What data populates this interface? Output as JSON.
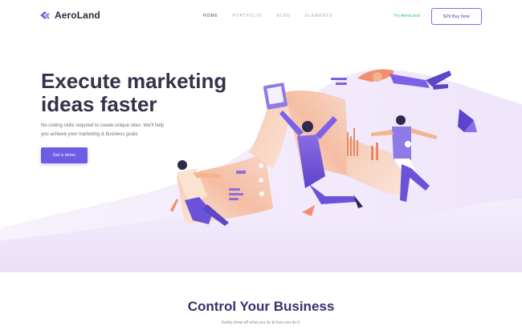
{
  "header": {
    "logo_text": "AeroLand",
    "nav": [
      {
        "label": "HOME",
        "active": true
      },
      {
        "label": "PORTFOLIO",
        "active": false
      },
      {
        "label": "BLOG",
        "active": false
      },
      {
        "label": "ELEMENTS",
        "active": false
      }
    ],
    "try_label": "Try AeroLand",
    "buy_label": "$29 Buy Now"
  },
  "hero": {
    "title_line1": "Execute marketing",
    "title_line2": "ideas faster",
    "subtitle_line1": "No coding skills required to create unique sites. We'll help",
    "subtitle_line2": "you achieve your marketing & business goals",
    "cta_label": "Get a demo"
  },
  "section": {
    "title": "Control Your Business",
    "subtitle": "Easily show off what you do & how you do it."
  },
  "colors": {
    "brand": "#6d5ce6",
    "accent_green": "#2dbf76",
    "hero_wave": "#efe8fb",
    "heading": "#33334a"
  }
}
